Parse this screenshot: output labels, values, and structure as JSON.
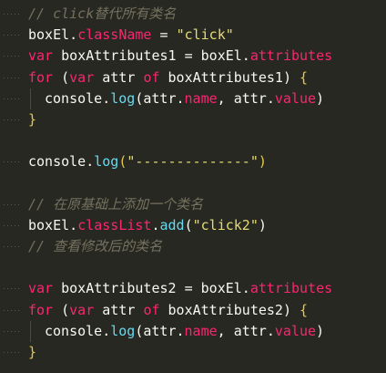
{
  "editor": {
    "lines": [
      {
        "type": "comment",
        "text": "// click替代所有类名"
      },
      {
        "type": "code",
        "tokens": [
          {
            "c": "plain",
            "t": "boxEl."
          },
          {
            "c": "prop",
            "t": "className"
          },
          {
            "c": "plain",
            "t": " = "
          },
          {
            "c": "str",
            "t": "\"click\""
          }
        ]
      },
      {
        "type": "code",
        "tokens": [
          {
            "c": "kw",
            "t": "var"
          },
          {
            "c": "plain",
            "t": " boxAttributes1 = boxEl."
          },
          {
            "c": "prop",
            "t": "attributes"
          }
        ]
      },
      {
        "type": "code",
        "tokens": [
          {
            "c": "kw",
            "t": "for"
          },
          {
            "c": "plain",
            "t": " ("
          },
          {
            "c": "kw",
            "t": "var"
          },
          {
            "c": "plain",
            "t": " attr "
          },
          {
            "c": "kw",
            "t": "of"
          },
          {
            "c": "plain",
            "t": " boxAttributes1) "
          },
          {
            "c": "brace-y",
            "t": "{"
          }
        ]
      },
      {
        "type": "code",
        "indent": true,
        "tokens": [
          {
            "c": "plain",
            "t": "console."
          },
          {
            "c": "func",
            "t": "log"
          },
          {
            "c": "plain",
            "t": "(attr."
          },
          {
            "c": "prop",
            "t": "name"
          },
          {
            "c": "plain",
            "t": ", attr."
          },
          {
            "c": "prop",
            "t": "value"
          },
          {
            "c": "plain",
            "t": ")"
          }
        ]
      },
      {
        "type": "code",
        "tokens": [
          {
            "c": "brace-y",
            "t": "}"
          }
        ]
      },
      {
        "type": "blank"
      },
      {
        "type": "code",
        "tokens": [
          {
            "c": "plain",
            "t": "console."
          },
          {
            "c": "func",
            "t": "log"
          },
          {
            "c": "brace-y",
            "t": "("
          },
          {
            "c": "str",
            "t": "\"--------------\""
          },
          {
            "c": "brace-y",
            "t": ")"
          }
        ]
      },
      {
        "type": "blank"
      },
      {
        "type": "comment",
        "text": "// 在原基础上添加一个类名"
      },
      {
        "type": "code",
        "tokens": [
          {
            "c": "plain",
            "t": "boxEl."
          },
          {
            "c": "prop",
            "t": "classList"
          },
          {
            "c": "plain",
            "t": "."
          },
          {
            "c": "func",
            "t": "add"
          },
          {
            "c": "plain",
            "t": "("
          },
          {
            "c": "str",
            "t": "\"click2\""
          },
          {
            "c": "plain",
            "t": ")"
          }
        ]
      },
      {
        "type": "comment",
        "text": "// 查看修改后的类名"
      },
      {
        "type": "blank"
      },
      {
        "type": "code",
        "tokens": [
          {
            "c": "kw",
            "t": "var"
          },
          {
            "c": "plain",
            "t": " boxAttributes2 = boxEl."
          },
          {
            "c": "prop",
            "t": "attributes"
          }
        ]
      },
      {
        "type": "code",
        "tokens": [
          {
            "c": "kw",
            "t": "for"
          },
          {
            "c": "plain",
            "t": " ("
          },
          {
            "c": "kw",
            "t": "var"
          },
          {
            "c": "plain",
            "t": " attr "
          },
          {
            "c": "kw",
            "t": "of"
          },
          {
            "c": "plain",
            "t": " boxAttributes2) "
          },
          {
            "c": "brace-y",
            "t": "{"
          }
        ]
      },
      {
        "type": "code",
        "indent": true,
        "tokens": [
          {
            "c": "plain",
            "t": "console."
          },
          {
            "c": "func",
            "t": "log"
          },
          {
            "c": "plain",
            "t": "(attr."
          },
          {
            "c": "prop",
            "t": "name"
          },
          {
            "c": "plain",
            "t": ", attr."
          },
          {
            "c": "prop",
            "t": "value"
          },
          {
            "c": "plain",
            "t": ")"
          }
        ]
      },
      {
        "type": "code",
        "tokens": [
          {
            "c": "brace-y",
            "t": "}"
          }
        ]
      }
    ]
  }
}
